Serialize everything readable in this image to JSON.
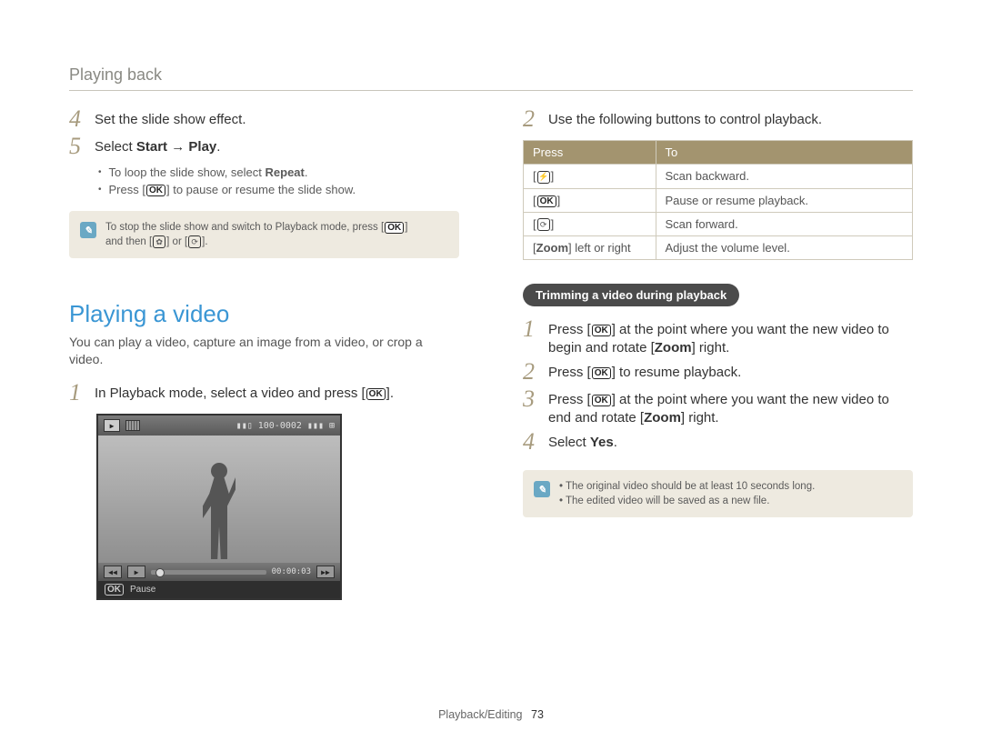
{
  "breadcrumb": "Playing back",
  "left": {
    "step4": {
      "num": "4",
      "text": "Set the slide show effect."
    },
    "step5": {
      "num": "5",
      "prefix": "Select ",
      "start": "Start",
      "arrow": " → ",
      "play": "Play",
      "suffix": "."
    },
    "step5_bullets": {
      "b1_pre": "To loop the slide show, select ",
      "b1_bold": "Repeat",
      "b1_post": ".",
      "b2_pre": "Press [",
      "b2_post": "] to pause or resume the slide show."
    },
    "note1": {
      "l1_pre": "To stop the slide show and switch to Playback mode, press [",
      "l1_post": "]",
      "l2_pre": "and then [",
      "l2_mid": "] or [",
      "l2_post": "]."
    },
    "section_title": "Playing a video",
    "section_desc": "You can play a video, capture an image from a video, or crop a video.",
    "pv_step1": {
      "num": "1",
      "pre": "In Playback mode, select a video and press [",
      "post": "]."
    },
    "thumb": {
      "file_id": "100-0002",
      "time": "00:00:03",
      "pause": "Pause"
    }
  },
  "right": {
    "r_step2": {
      "num": "2",
      "text": "Use the following buttons to control playback."
    },
    "table": {
      "h1": "Press",
      "h2": "To",
      "r1_to": "Scan backward.",
      "r2_to": "Pause or resume playback.",
      "r3_to": "Scan forward.",
      "r4_press_pre": "[",
      "r4_press_bold": "Zoom",
      "r4_press_post": "] left or right",
      "r4_to": "Adjust the volume level."
    },
    "pill": "Trimming a video during playback",
    "t_step1": {
      "num": "1",
      "pre": "Press [",
      "mid": "] at the point where you want the new video to begin and rotate [",
      "zoom": "Zoom",
      "post": "] right."
    },
    "t_step2": {
      "num": "2",
      "pre": "Press [",
      "post": "] to resume playback."
    },
    "t_step3": {
      "num": "3",
      "pre": "Press [",
      "mid": "] at the point where you want the new video to end and rotate [",
      "zoom": "Zoom",
      "post": "] right."
    },
    "t_step4": {
      "num": "4",
      "pre": "Select ",
      "yes": "Yes",
      "post": "."
    },
    "note2": {
      "b1": "The original video should be at least 10 seconds long.",
      "b2": "The edited video will be saved as a new file."
    }
  },
  "footer": {
    "section": "Playback/Editing",
    "page": "73"
  }
}
